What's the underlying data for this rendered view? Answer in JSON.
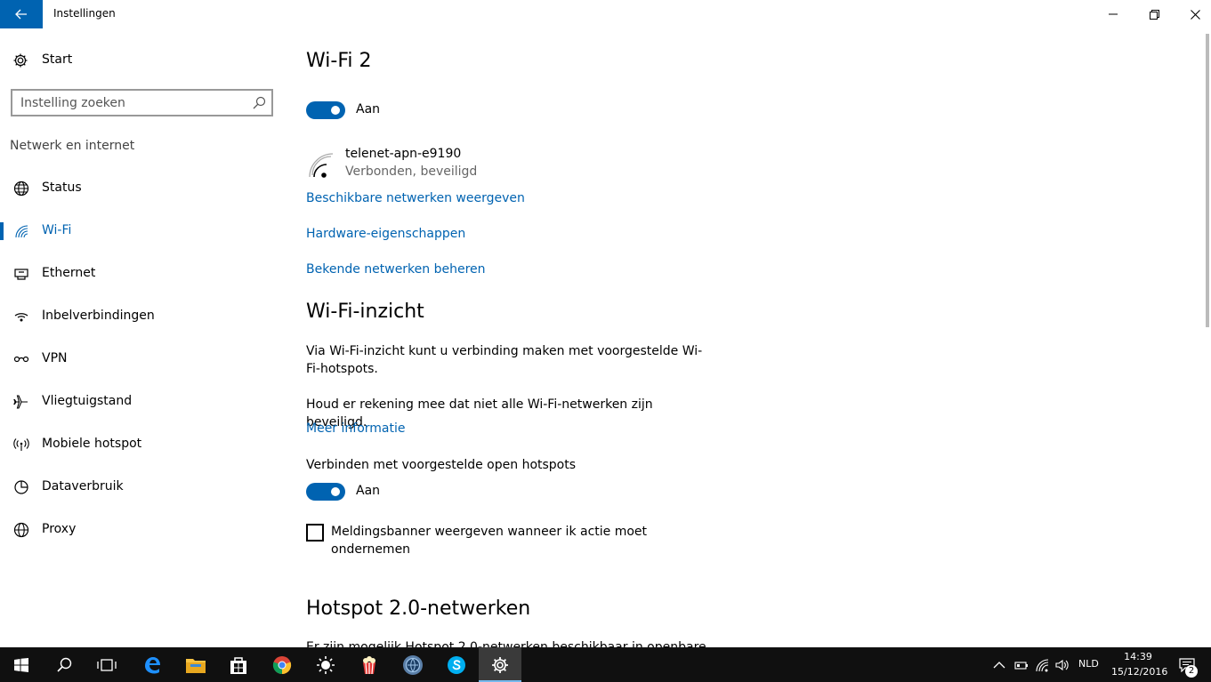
{
  "window": {
    "title": "Instellingen"
  },
  "sidebar": {
    "home_label": "Start",
    "search_placeholder": "Instelling zoeken",
    "group_label": "Netwerk en internet",
    "items": [
      {
        "label": "Status",
        "icon": "globe-status-icon"
      },
      {
        "label": "Wi-Fi",
        "icon": "wifi-icon",
        "active": true
      },
      {
        "label": "Ethernet",
        "icon": "ethernet-icon"
      },
      {
        "label": "Inbelverbindingen",
        "icon": "dialup-icon"
      },
      {
        "label": "VPN",
        "icon": "vpn-icon"
      },
      {
        "label": "Vliegtuigstand",
        "icon": "airplane-icon"
      },
      {
        "label": "Mobiele hotspot",
        "icon": "hotspot-icon"
      },
      {
        "label": "Dataverbruik",
        "icon": "data-usage-icon"
      },
      {
        "label": "Proxy",
        "icon": "proxy-globe-icon"
      }
    ]
  },
  "main": {
    "title": "Wi-Fi 2",
    "wifi_toggle_label": "Aan",
    "network": {
      "name": "telenet-apn-e9190",
      "status": "Verbonden, beveiligd"
    },
    "links": [
      "Beschikbare netwerken weergeven",
      "Hardware-eigenschappen",
      "Bekende netwerken beheren"
    ],
    "sense": {
      "title": "Wi-Fi-inzicht",
      "description": "Via Wi-Fi-inzicht kunt u verbinding maken met voorgestelde Wi-Fi-hotspots.",
      "warning": "Houd er rekening mee dat niet alle Wi-Fi-netwerken zijn beveiligd.",
      "more_info": "Meer informatie",
      "connect_label": "Verbinden met voorgestelde open hotspots",
      "connect_toggle_label": "Aan",
      "checkbox_label": "Meldingsbanner weergeven wanneer ik actie moet ondernemen"
    },
    "hotspot20": {
      "title": "Hotspot 2.0-netwerken",
      "partial_text": "Er zijn mogelijk Hotspot 2.0-netwerken beschikbaar in openbare"
    }
  },
  "taskbar": {
    "apps": [
      "start-icon",
      "search-icon",
      "task-view-icon",
      "edge-icon",
      "file-explorer-icon",
      "store-icon",
      "chrome-icon",
      "sun-app-icon",
      "popcorn-app-icon",
      "globe-app-icon",
      "skype-icon",
      "settings-icon"
    ],
    "language": "NLD",
    "time": "14:39",
    "date": "15/12/2016",
    "notification_count": "2"
  },
  "colors": {
    "accent": "#0063b1",
    "taskbar": "#101010"
  }
}
